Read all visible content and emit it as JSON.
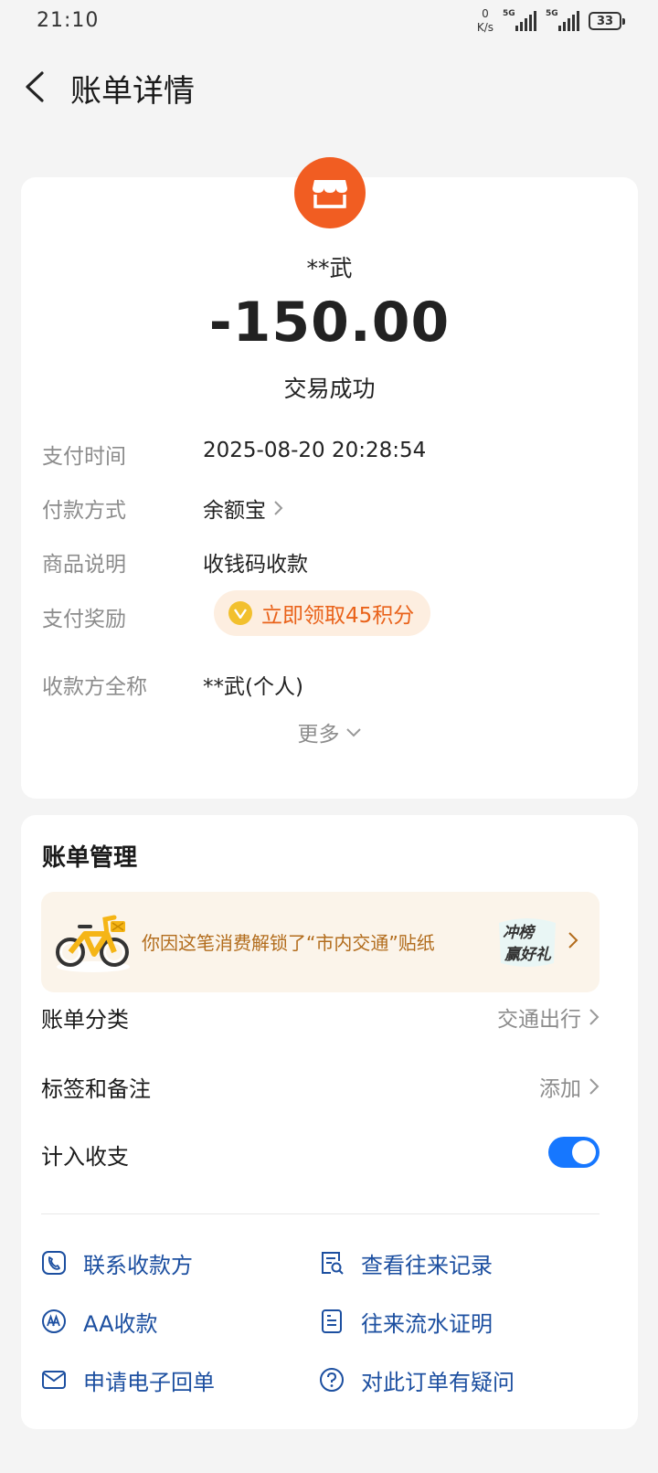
{
  "status_bar": {
    "time": "21:10",
    "net_speed_value": "0",
    "net_speed_unit": "K/s",
    "signal1_label": "5G",
    "signal2_label": "5G",
    "battery": "33"
  },
  "header": {
    "title": "账单详情"
  },
  "transaction": {
    "merchant_name": "**武",
    "amount": "-150.00",
    "status": "交易成功"
  },
  "details": [
    {
      "label": "支付时间",
      "value": "2025-08-20 20:28:54"
    },
    {
      "label": "付款方式",
      "value": "余额宝"
    },
    {
      "label": "商品说明",
      "value": "收钱码收款"
    },
    {
      "label": "支付奖励",
      "value": "立即领取45积分"
    },
    {
      "label": "收款方全称",
      "value": "**武(个人)"
    }
  ],
  "more_label": "更多",
  "bill_management": {
    "title": "账单管理",
    "banner_text": "你因这笔消费解锁了“市内交通”贴纸",
    "banner_badge_line1": "冲榜",
    "banner_badge_line2": "赢好礼",
    "category_label": "账单分类",
    "category_value": "交通出行",
    "tags_label": "标签和备注",
    "tags_value": "添加",
    "count_label": "计入收支",
    "count_enabled": true
  },
  "actions": [
    {
      "label": "联系收款方",
      "icon": "phone-icon"
    },
    {
      "label": "查看往来记录",
      "icon": "record-search-icon"
    },
    {
      "label": "AA收款",
      "icon": "aa-icon"
    },
    {
      "label": "往来流水证明",
      "icon": "document-icon"
    },
    {
      "label": "申请电子回单",
      "icon": "mail-icon"
    },
    {
      "label": "对此订单有疑问",
      "icon": "question-icon"
    }
  ],
  "colors": {
    "accent": "#1677ff",
    "merchant_icon_bg": "#f15d22",
    "reward_text": "#e9621a",
    "action_text": "#1c4fa0"
  }
}
